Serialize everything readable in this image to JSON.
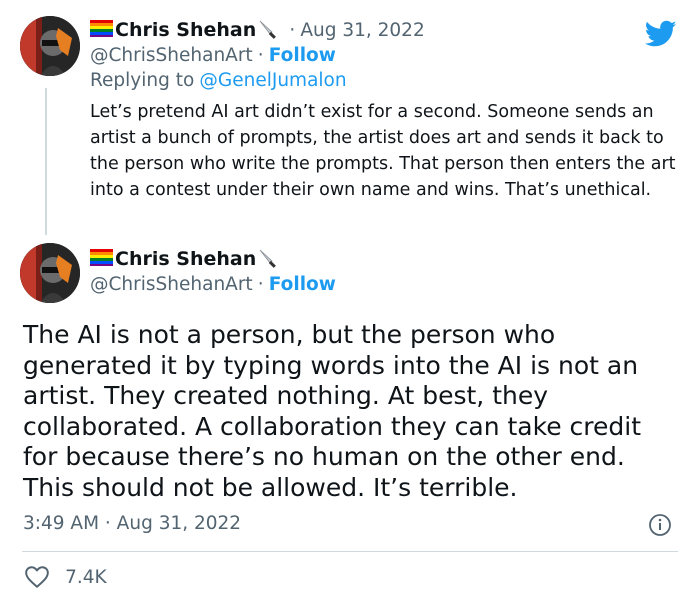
{
  "reply_tweet": {
    "display_name": "Chris Shehan",
    "date": "Aug 31, 2022",
    "date_separator": "·",
    "handle": "@ChrisShehanArt",
    "handle_separator": "·",
    "follow_label": "Follow",
    "replying_prefix": "Replying to",
    "replying_handle": "@GenelJumalon",
    "text": "Let’s pretend AI art didn’t exist for a second. Someone sends an artist a bunch of prompts, the artist does art and sends it back to the person who write the prompts. That person then enters the art into a contest under their own name and wins. That’s unethical."
  },
  "main_tweet": {
    "display_name": "Chris Shehan",
    "handle": "@ChrisShehanArt",
    "handle_separator": "·",
    "follow_label": "Follow",
    "text": "The AI is not a person, but the person who generated it by typing words into the AI is not an artist. They created nothing. At best, they collaborated. A collaboration they can take credit for because there’s no human on the other end. This should not be allowed. It’s terrible.",
    "timestamp": "3:49 AM · Aug 31, 2022",
    "like_count": "7.4K"
  },
  "icons": {
    "brand": "twitter-bird-icon",
    "info": "info-icon",
    "like": "heart-icon",
    "flag": "rainbow-flag-icon",
    "knife": "knife-icon"
  },
  "colors": {
    "accent": "#1d9bf0",
    "text": "#0f1419",
    "muted": "#536471",
    "divider": "#cfd9de"
  }
}
